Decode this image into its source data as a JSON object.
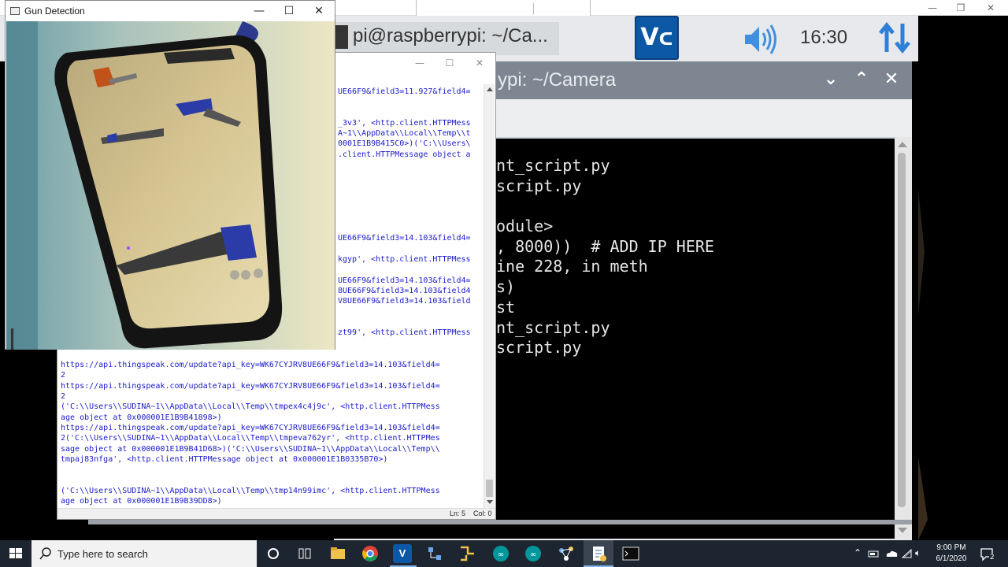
{
  "vnc_window": {
    "controls": [
      "—",
      "❐",
      "✕"
    ]
  },
  "pi_panel": {
    "task_title": "pi@raspberrypi: ~/Ca...",
    "vnc_logo": "V2",
    "clock": "16:30",
    "icons": [
      "terminal-icon",
      "vnc-icon",
      "speaker-icon",
      "network-arrows-icon"
    ]
  },
  "terminal": {
    "title": "ypi: ~/Camera",
    "controls": [
      "⌄",
      "⌃",
      "✕"
    ],
    "lines": [
      "nt_script.py",
      "script.py",
      "",
      "odule>",
      ", 8000))  # ADD IP HERE",
      "ine 228, in meth",
      "s)",
      "st",
      "nt_script.py",
      "script.py"
    ]
  },
  "shell": {
    "controls": [
      "—",
      "☐",
      "✕"
    ],
    "lines": [
      "UE66F9&field3=11.927&field4=",
      "_3v3', <http.client.HTTPMess",
      "A~1\\\\AppData\\\\Local\\\\Temp\\\\t",
      "0001E1B9B415C0>)('C:\\\\Users\\",
      ".client.HTTPMessage object a",
      "UE66F9&field3=14.103&field4=",
      "kgyp', <http.client.HTTPMess",
      "UE66F9&field3=14.103&field4=",
      "8UE66F9&field3=14.103&field4",
      "V8UE66F9&field3=14.103&field",
      "zt99', <http.client.HTTPMess",
      "https://api.thingspeak.com/update?api_key=WK67CYJRV8UE66F9&field3=14.103&field4=",
      "2",
      "https://api.thingspeak.com/update?api_key=WK67CYJRV8UE66F9&field3=14.103&field4=",
      "2",
      "('C:\\\\Users\\\\SUDINA~1\\\\AppData\\\\Local\\\\Temp\\\\tmpex4c4j9c', <http.client.HTTPMess",
      "age object at 0x000001E1B9B41898>)",
      "https://api.thingspeak.com/update?api_key=WK67CYJRV8UE66F9&field3=14.103&field4=",
      "2('C:\\\\Users\\\\SUDINA~1\\\\AppData\\\\Local\\\\Temp\\\\tmpeva762yr', <http.client.HTTPMes",
      "sage object at 0x000001E1B9B41D68>)('C:\\\\Users\\\\SUDINA~1\\\\AppData\\\\Local\\\\Temp\\\\",
      "tmpaj83nfga', <http.client.HTTPMessage object at 0x000001E1B0335B70>)",
      "('C:\\\\Users\\\\SUDINA~1\\\\AppData\\\\Local\\\\Temp\\\\tmp14n99imc', <http.client.HTTPMess",
      "age object at 0x000001E1B9B39DD8>)"
    ],
    "status_ln": "Ln: 5",
    "status_col": "Col: 0"
  },
  "camera_window": {
    "title": "Gun Detection",
    "controls": [
      "—",
      "☐",
      "✕"
    ]
  },
  "taskbar": {
    "search_placeholder": "Type here to search",
    "time": "9:00 PM",
    "date": "6/1/2020",
    "notification_count": "2",
    "colors": {
      "bar": "#1d2530",
      "chrome": "#db4437",
      "vnc": "#0d57a7",
      "arduino": "#00979c",
      "explorer": "#f0c24b"
    }
  }
}
